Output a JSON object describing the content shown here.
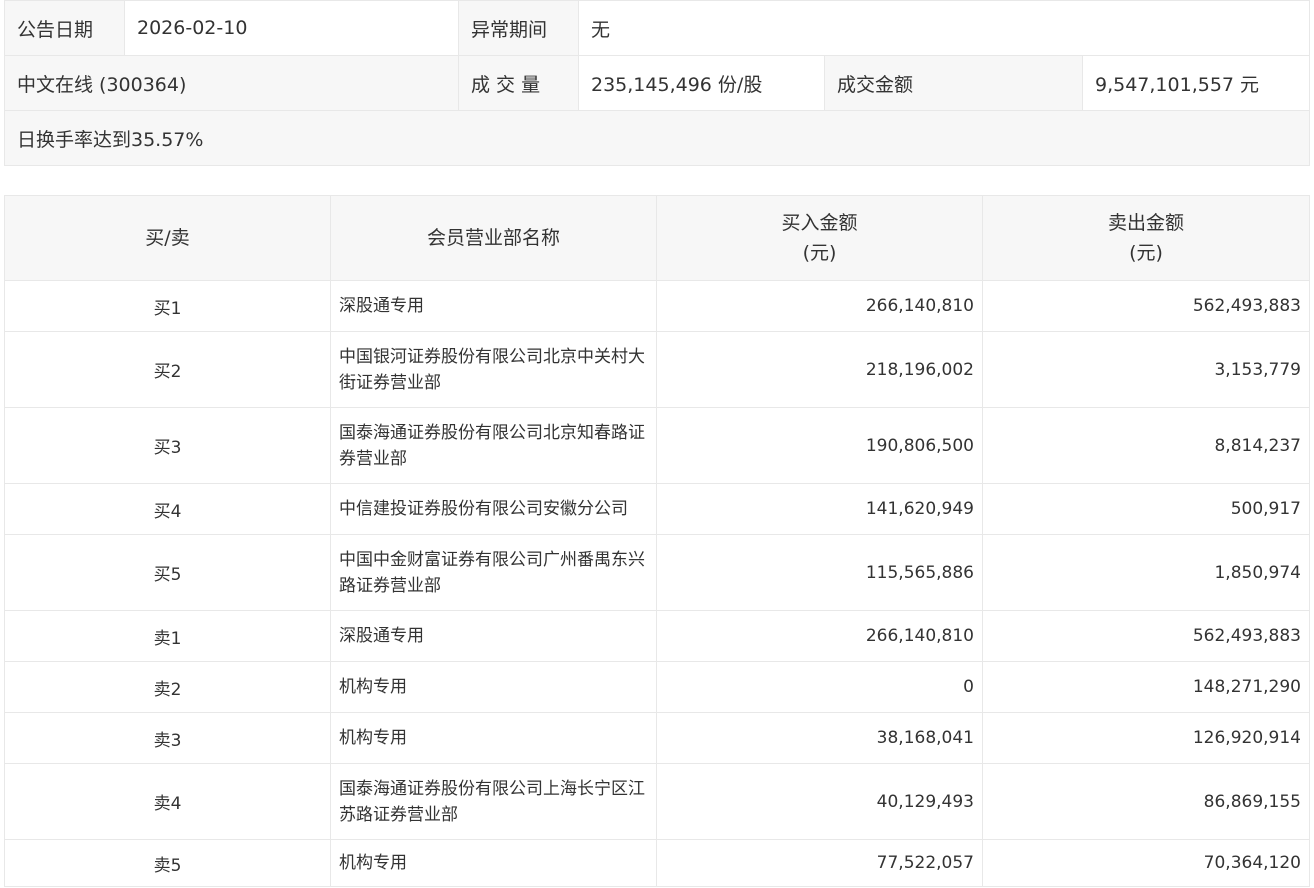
{
  "info": {
    "date_label": "公告日期",
    "date_value": "2026-02-10",
    "abnormal_label": "异常期间",
    "abnormal_value": "无",
    "stock": "中文在线 (300364)",
    "volume_label": "成 交 量",
    "volume_value": "235,145,496 份/股",
    "amount_label": "成交金额",
    "amount_value": "9,547,101,557 元",
    "reason": "日换手率达到35.57%"
  },
  "table": {
    "headers": {
      "side": "买/卖",
      "name": "会员营业部名称",
      "buy_line1": "买入金额",
      "buy_line2": "(元)",
      "sell_line1": "卖出金额",
      "sell_line2": "(元)"
    },
    "rows": [
      {
        "side": "买1",
        "name": "深股通专用",
        "buy": "266,140,810",
        "sell": "562,493,883"
      },
      {
        "side": "买2",
        "name": "中国银河证券股份有限公司北京中关村大街证券营业部",
        "buy": "218,196,002",
        "sell": "3,153,779"
      },
      {
        "side": "买3",
        "name": "国泰海通证券股份有限公司北京知春路证券营业部",
        "buy": "190,806,500",
        "sell": "8,814,237"
      },
      {
        "side": "买4",
        "name": "中信建投证券股份有限公司安徽分公司",
        "buy": "141,620,949",
        "sell": "500,917"
      },
      {
        "side": "买5",
        "name": "中国中金财富证券有限公司广州番禺东兴路证券营业部",
        "buy": "115,565,886",
        "sell": "1,850,974"
      },
      {
        "side": "卖1",
        "name": "深股通专用",
        "buy": "266,140,810",
        "sell": "562,493,883"
      },
      {
        "side": "卖2",
        "name": "机构专用",
        "buy": "0",
        "sell": "148,271,290"
      },
      {
        "side": "卖3",
        "name": "机构专用",
        "buy": "38,168,041",
        "sell": "126,920,914"
      },
      {
        "side": "卖4",
        "name": "国泰海通证券股份有限公司上海长宁区江苏路证券营业部",
        "buy": "40,129,493",
        "sell": "86,869,155"
      },
      {
        "side": "卖5",
        "name": "机构专用",
        "buy": "77,522,057",
        "sell": "70,364,120"
      }
    ]
  }
}
